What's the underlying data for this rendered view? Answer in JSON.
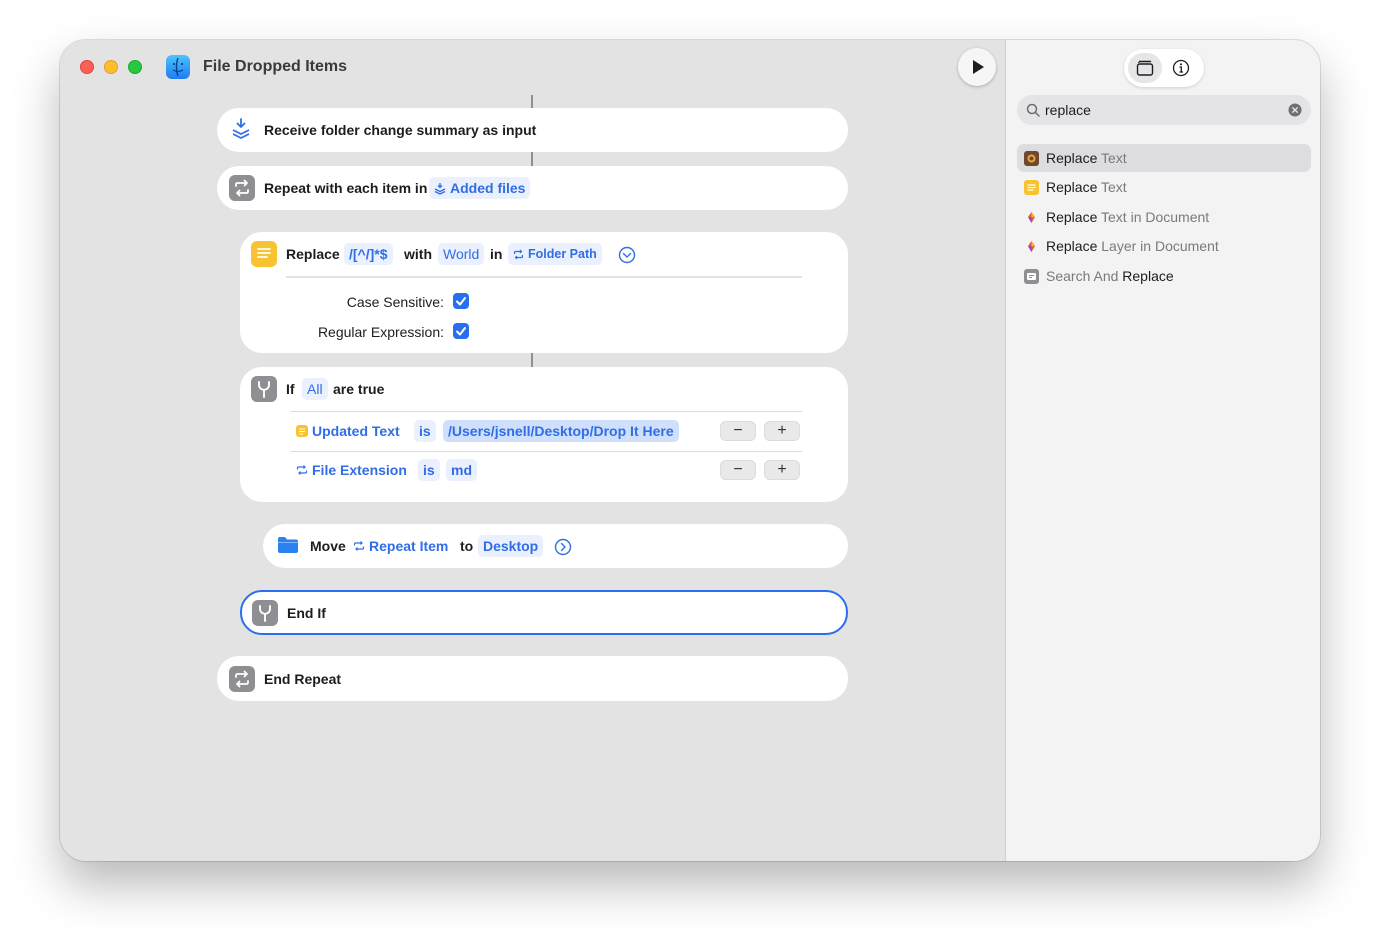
{
  "window": {
    "title": "File Dropped Items"
  },
  "actions": {
    "receive": {
      "label": "Receive folder change summary as input"
    },
    "repeat": {
      "label": "Repeat with each item in",
      "variable": "Added files"
    },
    "replace": {
      "label": "Replace",
      "pattern": "/[^/]*$",
      "with_label": "with",
      "replacement": "World",
      "in_label": "in",
      "source": "Folder Path",
      "options": [
        {
          "label": "Case Sensitive:",
          "checked": true
        },
        {
          "label": "Regular Expression:",
          "checked": true
        }
      ]
    },
    "if": {
      "label": "If",
      "mode": "All",
      "suffix": "are true",
      "conditions": [
        {
          "variable": "Updated Text",
          "operator": "is",
          "value": "/Users/jsnell/Desktop/Drop It Here"
        },
        {
          "variable": "File Extension",
          "operator": "is",
          "value": "md"
        }
      ],
      "remove_label": "−",
      "add_label": "+"
    },
    "move": {
      "label": "Move",
      "item": "Repeat Item",
      "to_label": "to",
      "destination": "Desktop"
    },
    "end_if": {
      "label": "End If"
    },
    "end_repeat": {
      "label": "End Repeat"
    }
  },
  "sidebar": {
    "search_value": "replace",
    "results": [
      {
        "match": "Replace",
        "rest": " Text",
        "icon": "picture-app-icon",
        "color": "#6b4a2f",
        "highlighted": true
      },
      {
        "match": "Replace",
        "rest": " Text",
        "icon": "text-app-icon",
        "color": "#f7c331",
        "highlighted": false
      },
      {
        "match": "Replace",
        "rest": " Text in Document",
        "icon": "pixelmator-icon",
        "color": "#e8583b",
        "highlighted": false
      },
      {
        "match": "Replace",
        "rest": " Layer in Document",
        "icon": "pixelmator-icon",
        "color": "#e8583b",
        "highlighted": false
      },
      {
        "prefix": "Search And ",
        "match": "Replace",
        "icon": "search-replace-icon",
        "color": "#8e8e93",
        "highlighted": false
      }
    ]
  },
  "colors": {
    "accent": "#2a6ef0",
    "token_text": "#2f6ee6",
    "window_bg": "#e3e3e3"
  }
}
